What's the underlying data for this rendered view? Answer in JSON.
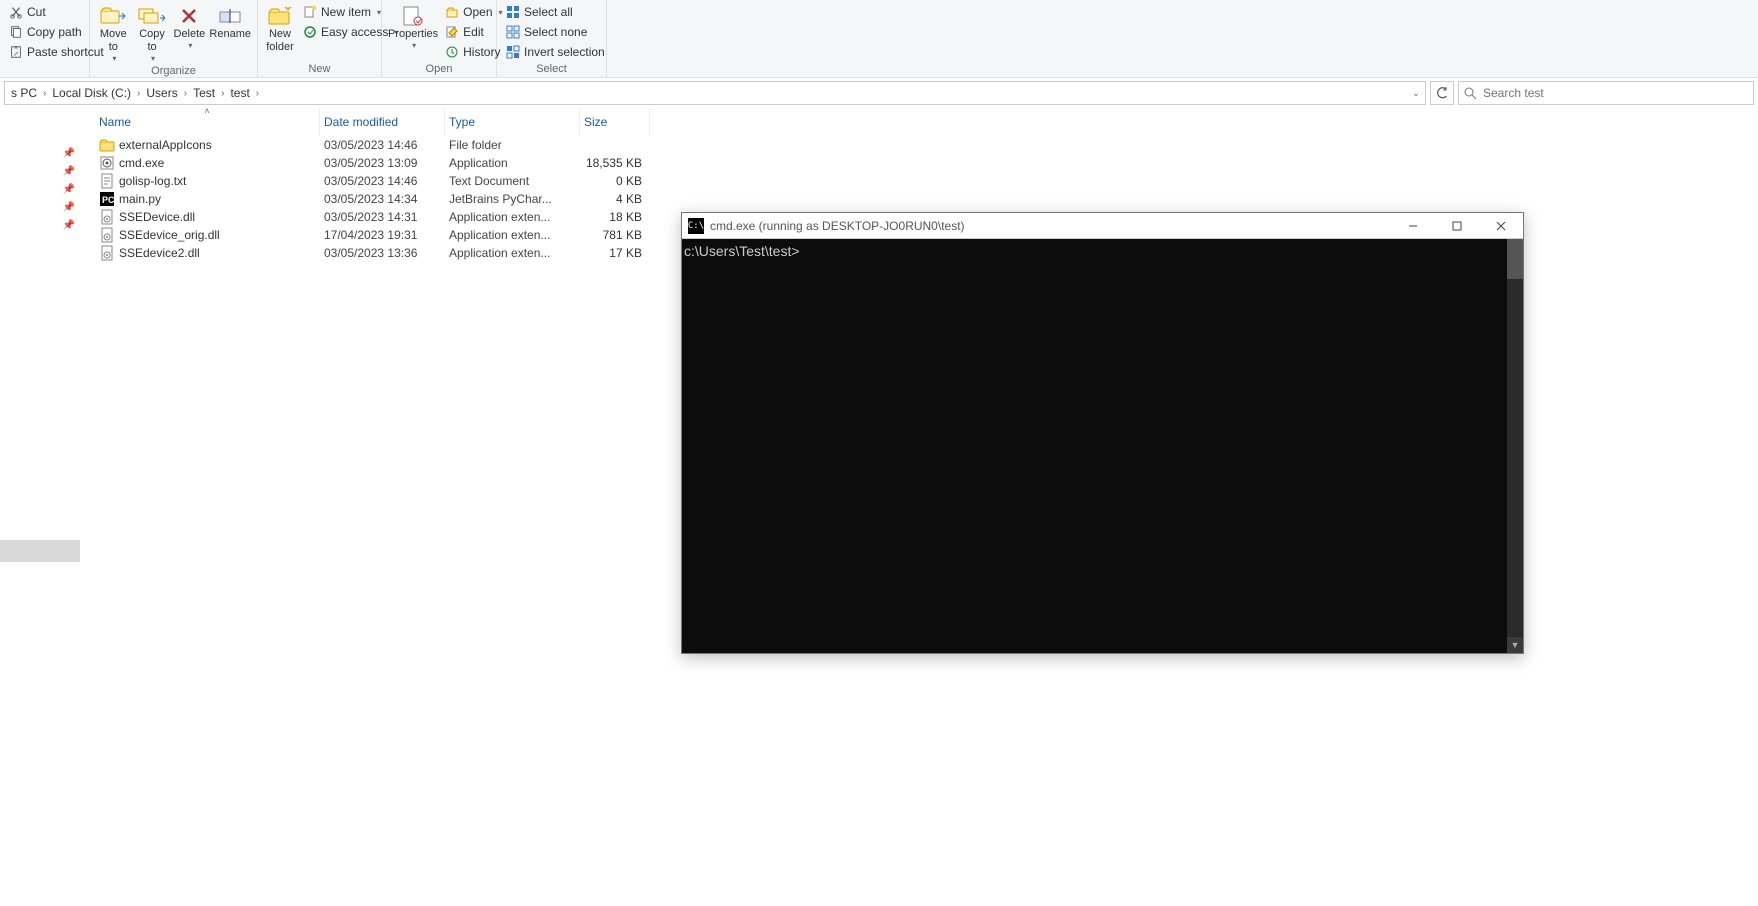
{
  "ribbon": {
    "clipboard": {
      "cut": "Cut",
      "copy_path": "Copy path",
      "paste_shortcut": "Paste shortcut"
    },
    "organize": {
      "move_to": "Move\nto",
      "copy_to": "Copy\nto",
      "delete": "Delete",
      "rename": "Rename",
      "label": "Organize"
    },
    "new": {
      "new_folder": "New\nfolder",
      "new_item": "New item",
      "easy_access": "Easy access",
      "label": "New"
    },
    "open": {
      "properties": "Properties",
      "open": "Open",
      "edit": "Edit",
      "history": "History",
      "label": "Open"
    },
    "select": {
      "select_all": "Select all",
      "select_none": "Select none",
      "invert": "Invert selection",
      "label": "Select"
    }
  },
  "breadcrumb": [
    "s PC",
    "Local Disk (C:)",
    "Users",
    "Test",
    "test"
  ],
  "search": {
    "placeholder": "Search test"
  },
  "columns": {
    "name": "Name",
    "date": "Date modified",
    "type": "Type",
    "size": "Size"
  },
  "files": [
    {
      "icon": "folder",
      "name": "externalAppIcons",
      "date": "03/05/2023 14:46",
      "type": "File folder",
      "size": ""
    },
    {
      "icon": "exe",
      "name": "cmd.exe",
      "date": "03/05/2023 13:09",
      "type": "Application",
      "size": "18,535 KB"
    },
    {
      "icon": "txt",
      "name": "golisp-log.txt",
      "date": "03/05/2023 14:46",
      "type": "Text Document",
      "size": "0 KB"
    },
    {
      "icon": "pc",
      "name": "main.py",
      "date": "03/05/2023 14:34",
      "type": "JetBrains PyChar...",
      "size": "4 KB"
    },
    {
      "icon": "dll",
      "name": "SSEDevice.dll",
      "date": "03/05/2023 14:31",
      "type": "Application exten...",
      "size": "18 KB"
    },
    {
      "icon": "dll",
      "name": "SSEdevice_orig.dll",
      "date": "17/04/2023 19:31",
      "type": "Application exten...",
      "size": "781 KB"
    },
    {
      "icon": "dll",
      "name": "SSEdevice2.dll",
      "date": "03/05/2023 13:36",
      "type": "Application exten...",
      "size": "17 KB"
    }
  ],
  "cmd": {
    "title": "cmd.exe (running as DESKTOP-JO0RUN0\\test)",
    "prompt": "c:\\Users\\Test\\test>"
  }
}
